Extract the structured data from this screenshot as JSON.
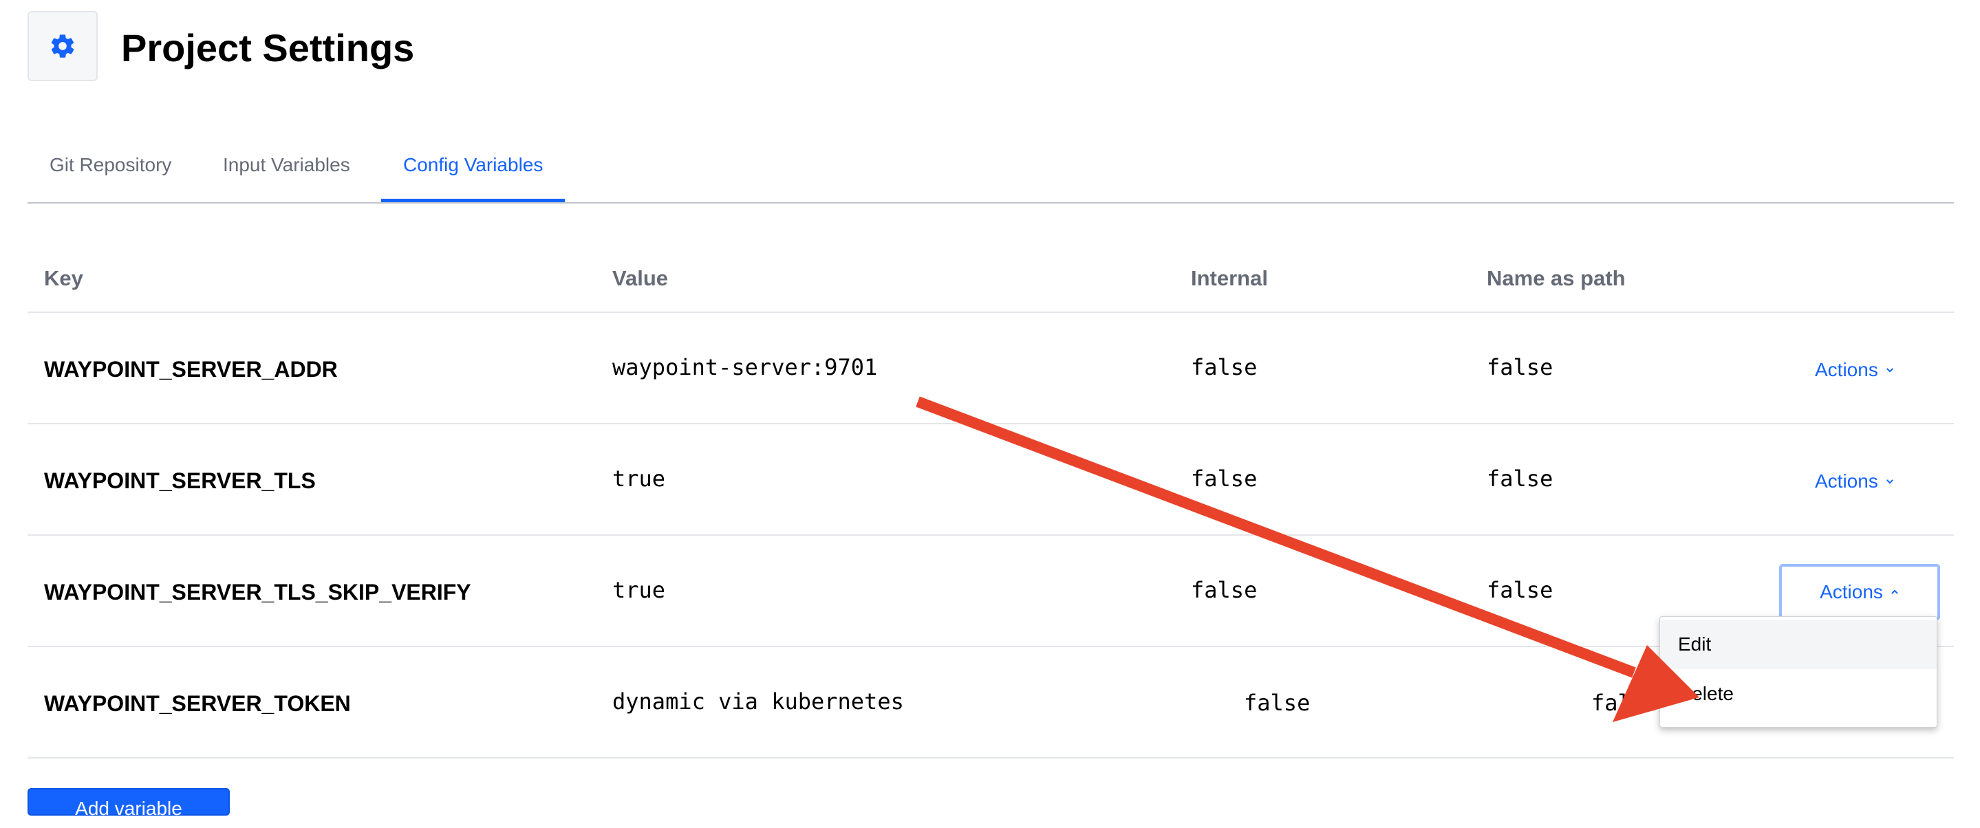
{
  "header": {
    "title": "Project Settings",
    "icon": "gear-icon"
  },
  "tabs": [
    {
      "label": "Git Repository",
      "active": false
    },
    {
      "label": "Input Variables",
      "active": false
    },
    {
      "label": "Config Variables",
      "active": true
    }
  ],
  "table": {
    "columns": [
      "Key",
      "Value",
      "Internal",
      "Name as path"
    ],
    "rows": [
      {
        "key": "WAYPOINT_SERVER_ADDR",
        "value": "waypoint-server:9701",
        "internal": "false",
        "name_as_path": "false",
        "actions": "Actions"
      },
      {
        "key": "WAYPOINT_SERVER_TLS",
        "value": "true",
        "internal": "false",
        "name_as_path": "false",
        "actions": "Actions"
      },
      {
        "key": "WAYPOINT_SERVER_TLS_SKIP_VERIFY",
        "value": "true",
        "internal": "false",
        "name_as_path": "false",
        "actions": "Actions"
      },
      {
        "key": "WAYPOINT_SERVER_TOKEN",
        "value": "dynamic via kubernetes",
        "internal": "false",
        "name_as_path": "false"
      }
    ]
  },
  "actions_menu": {
    "items": [
      "Edit",
      "Delete"
    ]
  },
  "add_button": {
    "label": "Add variable"
  },
  "colors": {
    "accent": "#1563ff",
    "annotation_arrow": "#e8432a",
    "muted_text": "#656a76"
  }
}
